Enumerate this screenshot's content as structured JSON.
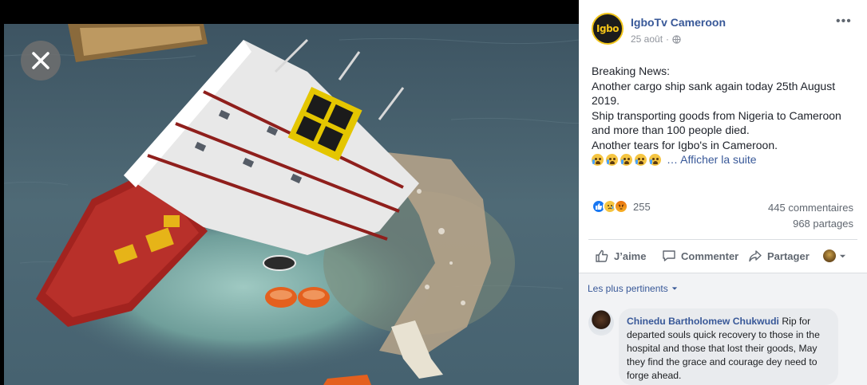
{
  "viewer": {
    "close_icon": "close-icon"
  },
  "post": {
    "avatar_logo": "Igbo",
    "page_name": "IgboTv Cameroon",
    "date": "25 août",
    "privacy_icon": "globe-icon",
    "more_label": "•••",
    "text_lines": [
      "Breaking News:",
      "Another cargo ship sank again today 25th August 2019.",
      "Ship transporting goods from Nigeria to Cameroon and more than 100 people died.",
      "Another tears for Igbo's in Cameroon."
    ],
    "emoji_count": 5,
    "see_more": "… Afficher la suite",
    "reaction_count": "255",
    "comments_count": "445 commentaires",
    "shares_count": "968 partages",
    "colors": {
      "link": "#385898",
      "like": "#1877f2",
      "sad": "#f5c542",
      "angry": "#e9710f"
    }
  },
  "actions": {
    "like": "J’aime",
    "comment": "Commenter",
    "share": "Partager"
  },
  "comments": {
    "sort_label": "Les plus pertinents",
    "items": [
      {
        "author": "Chinedu Bartholomew Chukwudi",
        "text": "Rip for departed souls quick recovery to those in the hospital and those that lost their goods, May they find the grace and courage dey need to forge ahead."
      }
    ]
  }
}
